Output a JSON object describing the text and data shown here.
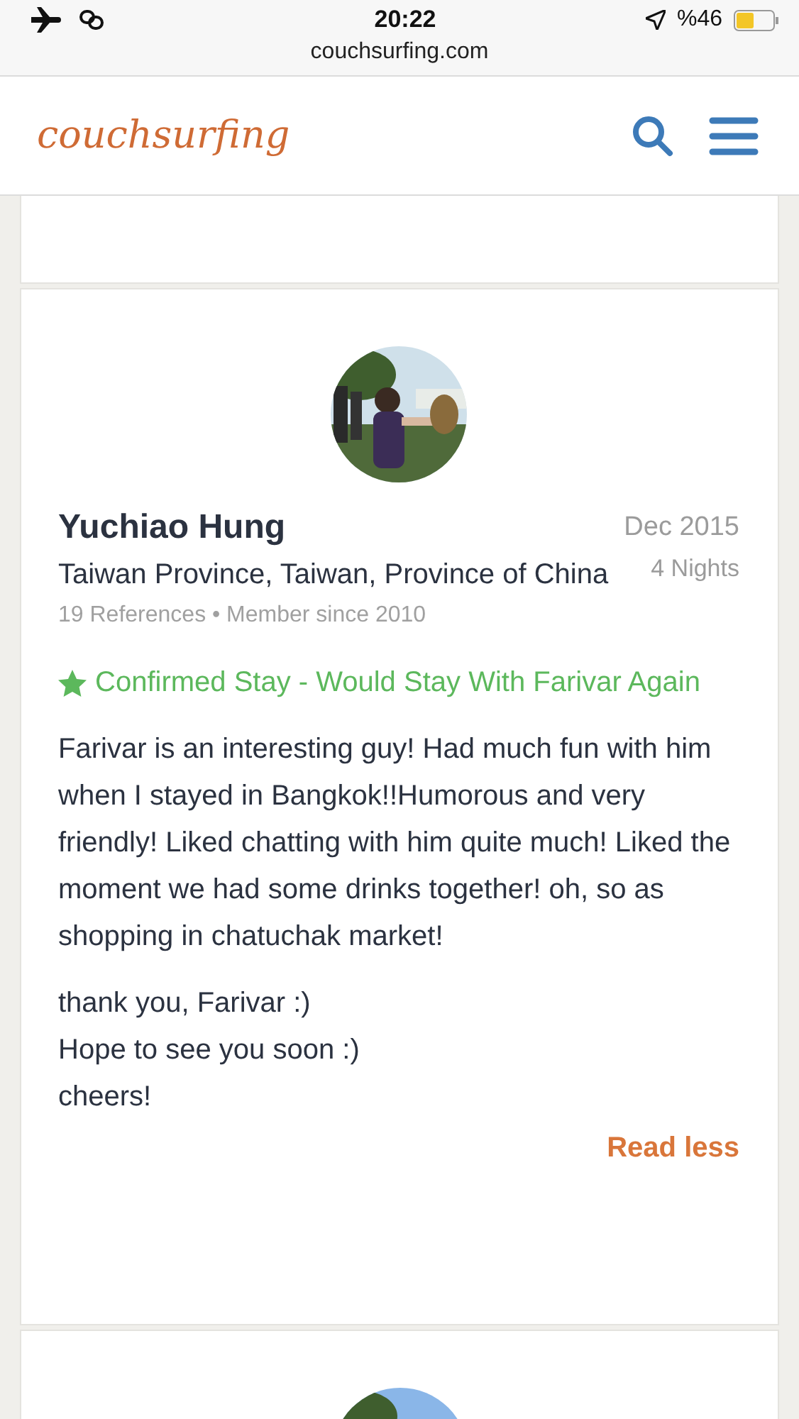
{
  "status_bar": {
    "time": "20:22",
    "battery": "%46"
  },
  "browser": {
    "url": "couchsurfing.com"
  },
  "header": {
    "logo": "couchsurfing"
  },
  "references": [
    {
      "name": "Yuchiao Hung",
      "date": "Dec 2015",
      "location": "Taiwan Province, Taiwan, Province of China",
      "nights": "4 Nights",
      "meta": "19 References • Member since 2010",
      "experience": "Confirmed Stay - Would Stay With Farivar Again",
      "paragraphs": [
        "Farivar is an interesting guy! Had much fun with him when I stayed in Bangkok!!Humorous and very friendly! Liked chatting with him quite much! Liked the moment we had some drinks together! oh, so as shopping in chatuchak market!",
        "thank you, Farivar :)\nHope to see you soon :)\ncheers!"
      ],
      "toggle": "Read less"
    }
  ]
}
